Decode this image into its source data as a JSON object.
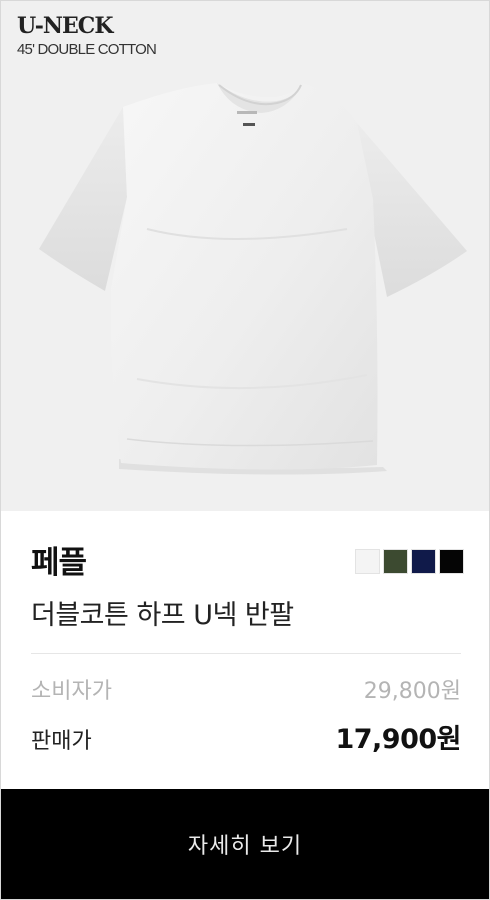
{
  "hero": {
    "title": "U-NECK",
    "subtitle": "45' DOUBLE COTTON",
    "image_label": "white t-shirt"
  },
  "product": {
    "brand": "페플",
    "name": "더블코튼 하프 U넥 반팔",
    "swatches": [
      {
        "name": "white",
        "color": "#f4f4f4"
      },
      {
        "name": "olive",
        "color": "#3c4a30"
      },
      {
        "name": "navy",
        "color": "#101a4a"
      },
      {
        "name": "black",
        "color": "#050505"
      }
    ]
  },
  "pricing": {
    "retail_label": "소비자가",
    "retail_price": "29,800원",
    "sale_label": "판매가",
    "sale_price": "17,900원"
  },
  "cta": {
    "label": "자세히 보기"
  }
}
